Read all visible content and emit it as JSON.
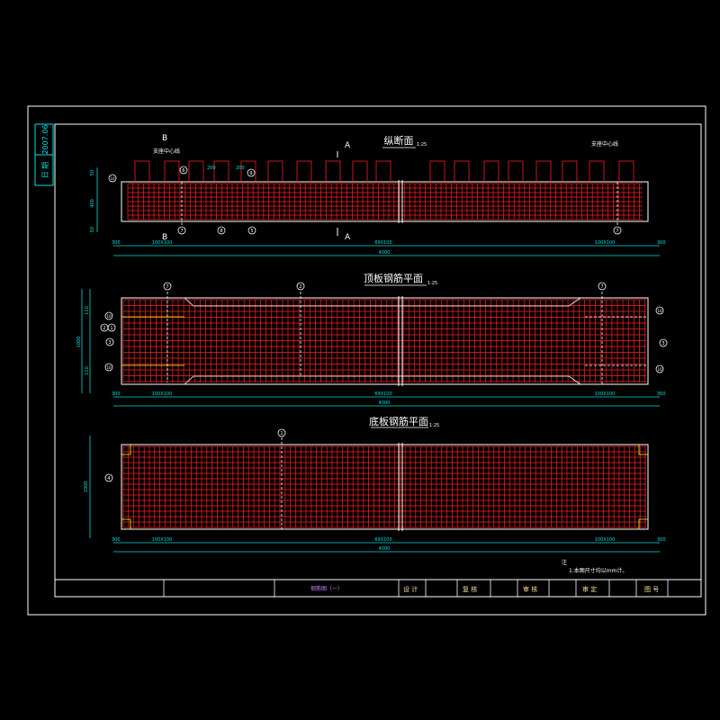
{
  "side_stamp": {
    "code": "2007.06",
    "label": "日 期"
  },
  "views": {
    "longitudinal": {
      "title": "纵断面",
      "scale": "1:25"
    },
    "top_slab": {
      "title": "顶板钢筋平面",
      "scale": "1:25"
    },
    "bottom_slab": {
      "title": "底板钢筋平面",
      "scale": "1:25"
    }
  },
  "section_marks": {
    "a": "A",
    "b": "B"
  },
  "support_label": "支座中心线",
  "dims": {
    "side": "300",
    "left_run": "100X100",
    "mid_run": "69X100",
    "right_run": "100X100",
    "total": "4000",
    "pitch": "200",
    "height_a": "50",
    "height_b": "400",
    "height_c": "50",
    "width_total": "1000",
    "width_part": "110"
  },
  "markers": {
    "m1": "1",
    "m2": "2",
    "m3": "3",
    "m4": "4",
    "m5": "5",
    "m6": "6",
    "m7": "7",
    "m8": "8",
    "m9": "9",
    "m10": "10"
  },
  "notes": {
    "title": "注",
    "line1": "1.本图尺寸均以mm计。"
  },
  "title_block": {
    "drawing_name": "钢筋图（一）",
    "design": "设 计",
    "review": "复 核",
    "check": "审 核",
    "approve": "审 定",
    "sheet": "图 号"
  },
  "colors": {
    "frame": "#ffffff",
    "rebar": "#ff2020",
    "dim": "#00e0e0",
    "text": "#ffffff",
    "accent": "#ffff00",
    "title_text": "#ffe0a0"
  }
}
